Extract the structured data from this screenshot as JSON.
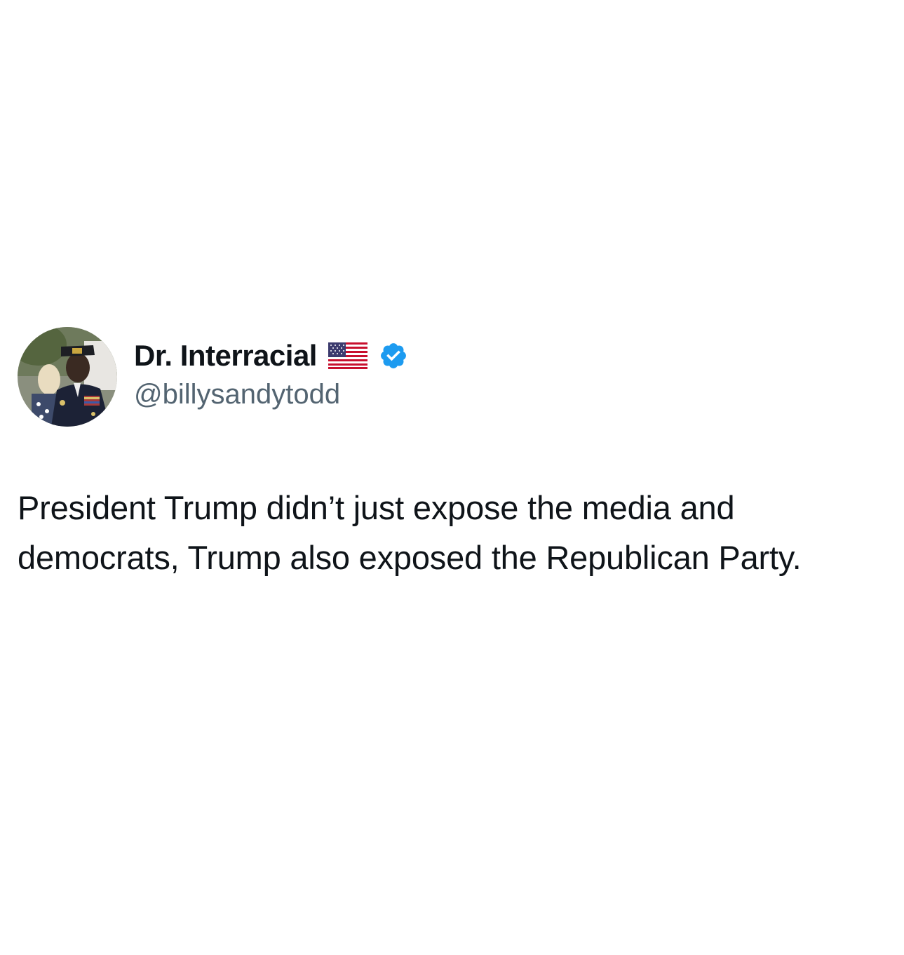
{
  "post": {
    "author": {
      "display_name": "Dr. Interracial",
      "handle": "@billysandytodd",
      "flag_icon": "us-flag-icon",
      "verified_icon": "verified-badge-icon",
      "verified_color": "#1d9bf0"
    },
    "text": "President Trump didn’t just expose the media and democrats, Trump also exposed the Republican Party."
  },
  "colors": {
    "background": "#ffffff",
    "text_primary": "#0f1419",
    "text_secondary": "#536471"
  }
}
